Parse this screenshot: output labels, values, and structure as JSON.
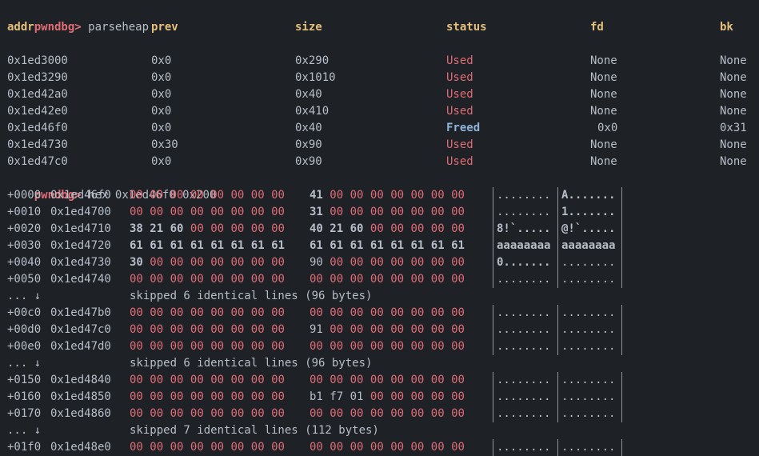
{
  "prompt": "pwndbg>",
  "cmd1": "parseheap",
  "cmd2": "hex 0x1ed46f0 0x200",
  "headers": [
    "addr",
    "prev",
    "size",
    "status",
    "fd",
    "bk"
  ],
  "heap_rows": [
    {
      "addr": "0x1ed3000",
      "prev": "0x0",
      "size": "0x290",
      "status": "Used",
      "fd": "None",
      "bk": "None"
    },
    {
      "addr": "0x1ed3290",
      "prev": "0x0",
      "size": "0x1010",
      "status": "Used",
      "fd": "None",
      "bk": "None"
    },
    {
      "addr": "0x1ed42a0",
      "prev": "0x0",
      "size": "0x40",
      "status": "Used",
      "fd": "None",
      "bk": "None"
    },
    {
      "addr": "0x1ed42e0",
      "prev": "0x0",
      "size": "0x410",
      "status": "Used",
      "fd": "None",
      "bk": "None"
    },
    {
      "addr": "0x1ed46f0",
      "prev": "0x0",
      "size": "0x40",
      "status": "Freed",
      "fd": "0x0",
      "bk": "0x31"
    },
    {
      "addr": "0x1ed4730",
      "prev": "0x30",
      "size": "0x90",
      "status": "Used",
      "fd": "None",
      "bk": "None"
    },
    {
      "addr": "0x1ed47c0",
      "prev": "0x0",
      "size": "0x90",
      "status": "Used",
      "fd": "None",
      "bk": "None"
    }
  ],
  "hex_rows": [
    {
      "type": "row",
      "off": "+0000",
      "addr": "0x1ed46f0",
      "b1": "00 00 00 00 00 00 00 00",
      "b2": "41 00 00 00 00 00 00 00",
      "a1": "........",
      "a2": "A......."
    },
    {
      "type": "row",
      "off": "+0010",
      "addr": "0x1ed4700",
      "b1": "00 00 00 00 00 00 00 00",
      "b2": "31 00 00 00 00 00 00 00",
      "a1": "........",
      "a2": "1......."
    },
    {
      "type": "row",
      "off": "+0020",
      "addr": "0x1ed4710",
      "b1": "38 21 60 00 00 00 00 00",
      "b2": "40 21 60 00 00 00 00 00",
      "a1": "8!`.....",
      "a2": "@!`....."
    },
    {
      "type": "row",
      "off": "+0030",
      "addr": "0x1ed4720",
      "b1": "61 61 61 61 61 61 61 61",
      "b2": "61 61 61 61 61 61 61 61",
      "a1": "aaaaaaaa",
      "a2": "aaaaaaaa"
    },
    {
      "type": "row",
      "off": "+0040",
      "addr": "0x1ed4730",
      "b1": "30 00 00 00 00 00 00 00",
      "b2": "90 00 00 00 00 00 00 00",
      "a1": "0.......",
      "a2": "........"
    },
    {
      "type": "row",
      "off": "+0050",
      "addr": "0x1ed4740",
      "b1": "00 00 00 00 00 00 00 00",
      "b2": "00 00 00 00 00 00 00 00",
      "a1": "........",
      "a2": "........"
    },
    {
      "type": "skip",
      "prefix": "... ↓",
      "text": "skipped 6 identical lines (96 bytes)"
    },
    {
      "type": "row",
      "off": "+00c0",
      "addr": "0x1ed47b0",
      "b1": "00 00 00 00 00 00 00 00",
      "b2": "00 00 00 00 00 00 00 00",
      "a1": "........",
      "a2": "........"
    },
    {
      "type": "row",
      "off": "+00d0",
      "addr": "0x1ed47c0",
      "b1": "00 00 00 00 00 00 00 00",
      "b2": "91 00 00 00 00 00 00 00",
      "a1": "........",
      "a2": "........"
    },
    {
      "type": "row",
      "off": "+00e0",
      "addr": "0x1ed47d0",
      "b1": "00 00 00 00 00 00 00 00",
      "b2": "00 00 00 00 00 00 00 00",
      "a1": "........",
      "a2": "........"
    },
    {
      "type": "skip",
      "prefix": "... ↓",
      "text": "skipped 6 identical lines (96 bytes)"
    },
    {
      "type": "row",
      "off": "+0150",
      "addr": "0x1ed4840",
      "b1": "00 00 00 00 00 00 00 00",
      "b2": "00 00 00 00 00 00 00 00",
      "a1": "........",
      "a2": "........"
    },
    {
      "type": "row",
      "off": "+0160",
      "addr": "0x1ed4850",
      "b1": "00 00 00 00 00 00 00 00",
      "b2": "b1 f7 01 00 00 00 00 00",
      "a1": "........",
      "a2": "........"
    },
    {
      "type": "row",
      "off": "+0170",
      "addr": "0x1ed4860",
      "b1": "00 00 00 00 00 00 00 00",
      "b2": "00 00 00 00 00 00 00 00",
      "a1": "........",
      "a2": "........"
    },
    {
      "type": "skip",
      "prefix": "... ↓",
      "text": "skipped 7 identical lines (112 bytes)"
    },
    {
      "type": "row",
      "off": "+01f0",
      "addr": "0x1ed48e0",
      "b1": "00 00 00 00 00 00 00 00",
      "b2": "00 00 00 00 00 00 00 00",
      "a1": "........",
      "a2": "........"
    }
  ]
}
